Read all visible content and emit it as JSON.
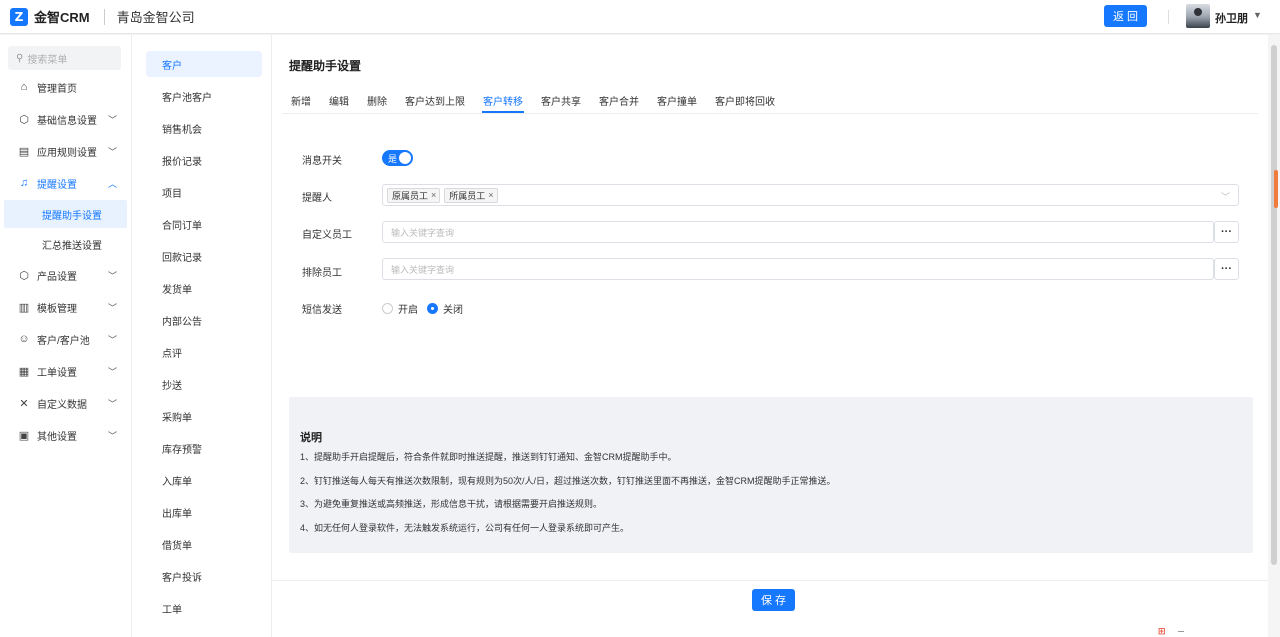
{
  "header": {
    "logo_glyph": "Z",
    "brand": "金智CRM",
    "company": "青岛金智公司",
    "back_label": "返 回",
    "user_name": "孙卫朋"
  },
  "sidebar": {
    "search_placeholder": "搜索菜单",
    "items": [
      {
        "label": "管理首页",
        "icon": "home-icon"
      },
      {
        "label": "基础信息设置",
        "icon": "cube-icon"
      },
      {
        "label": "应用规则设置",
        "icon": "document-icon"
      },
      {
        "label": "提醒设置",
        "icon": "bell-icon"
      },
      {
        "label": "提醒助手设置"
      },
      {
        "label": "汇总推送设置"
      },
      {
        "label": "产品设置",
        "icon": "box-icon"
      },
      {
        "label": "模板管理",
        "icon": "template-icon"
      },
      {
        "label": "客户/客户池",
        "icon": "users-icon"
      },
      {
        "label": "工单设置",
        "icon": "ticket-icon"
      },
      {
        "label": "自定义数据",
        "icon": "tools-icon"
      },
      {
        "label": "其他设置",
        "icon": "grid-icon"
      }
    ]
  },
  "second_menu": [
    "客户",
    "客户池客户",
    "销售机会",
    "报价记录",
    "项目",
    "合同订单",
    "回款记录",
    "发货单",
    "内部公告",
    "点评",
    "抄送",
    "采购单",
    "库存预警",
    "入库单",
    "出库单",
    "借货单",
    "客户投诉",
    "工单"
  ],
  "main": {
    "title": "提醒助手设置",
    "tabs": [
      "新增",
      "编辑",
      "删除",
      "客户达到上限",
      "客户转移",
      "客户共享",
      "客户合并",
      "客户撞单",
      "客户即将回收"
    ],
    "active_tab": "客户转移",
    "form": {
      "switch_label": "消息开关",
      "switch_on_text": "是",
      "reminder_label": "提醒人",
      "reminder_tags": [
        "原属员工",
        "所属员工"
      ],
      "custom_label": "自定义员工",
      "custom_placeholder": "输入关键字查询",
      "exclude_label": "排除员工",
      "exclude_placeholder": "输入关键字查询",
      "dots": "···",
      "sms_label": "短信发送",
      "sms_options": [
        "开启",
        "关闭"
      ],
      "sms_selected": "关闭"
    },
    "note": {
      "title": "说明",
      "lines": [
        "1、提醒助手开启提醒后，符合条件就即时推送提醒，推送到钉钉通知、金智CRM提醒助手中。",
        "2、钉钉推送每人每天有推送次数限制，现有规则为50次/人/日，超过推送次数，钉钉推送里面不再推送，金智CRM提醒助手正常推送。",
        "3、为避免重复推送或高频推送，形成信息干扰，请根据需要开启推送规则。",
        "4、如无任何人登录软件，无法触发系统运行，公司有任何一人登录系统即可产生。"
      ]
    },
    "save_label": "保 存"
  }
}
